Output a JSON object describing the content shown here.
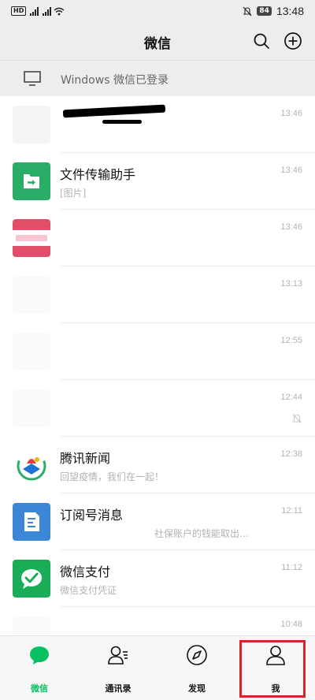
{
  "status_bar": {
    "network": "HD",
    "battery": "84",
    "time": "13:48"
  },
  "header": {
    "title": "微信",
    "search_icon": "search-icon",
    "add_icon": "plus-circle-icon"
  },
  "pc_banner": {
    "text": "Windows 微信已登录",
    "icon": "monitor-icon"
  },
  "chats": [
    {
      "name": "",
      "preview": "",
      "time": "13:46",
      "avatar": "blurred"
    },
    {
      "name": "文件传输助手",
      "preview": "[图片]",
      "time": "13:46",
      "avatar": "file-transfer-icon"
    },
    {
      "name": "",
      "preview": "",
      "time": "13:46",
      "avatar": "blurred-pink"
    },
    {
      "name": "",
      "preview": "",
      "time": "13:13",
      "avatar": "blurred"
    },
    {
      "name": "",
      "preview": "",
      "time": "12:55",
      "avatar": "blurred"
    },
    {
      "name": "",
      "preview": "",
      "time": "12:44",
      "avatar": "blurred",
      "muted": true
    },
    {
      "name": "腾讯新闻",
      "preview": "回望疫情，我们在一起！",
      "time": "12:38",
      "avatar": "tencent-news-icon"
    },
    {
      "name": "订阅号消息",
      "preview": "社保账户的钱能取出...",
      "time": "12:11",
      "avatar": "subscription-icon"
    },
    {
      "name": "微信支付",
      "preview": "微信支付凭证",
      "time": "11:12",
      "avatar": "wechat-pay-icon"
    },
    {
      "name": "",
      "preview": "",
      "time": "10:48",
      "avatar": "blurred"
    }
  ],
  "bottom_nav": [
    {
      "label": "微信",
      "icon": "chat-bubble-icon",
      "active": true
    },
    {
      "label": "通讯录",
      "icon": "contacts-icon",
      "active": false
    },
    {
      "label": "发现",
      "icon": "compass-icon",
      "active": false
    },
    {
      "label": "我",
      "icon": "person-icon",
      "active": false
    }
  ],
  "colors": {
    "accent": "#07c160",
    "highlight": "#d8232a",
    "header_bg": "#ededed"
  }
}
